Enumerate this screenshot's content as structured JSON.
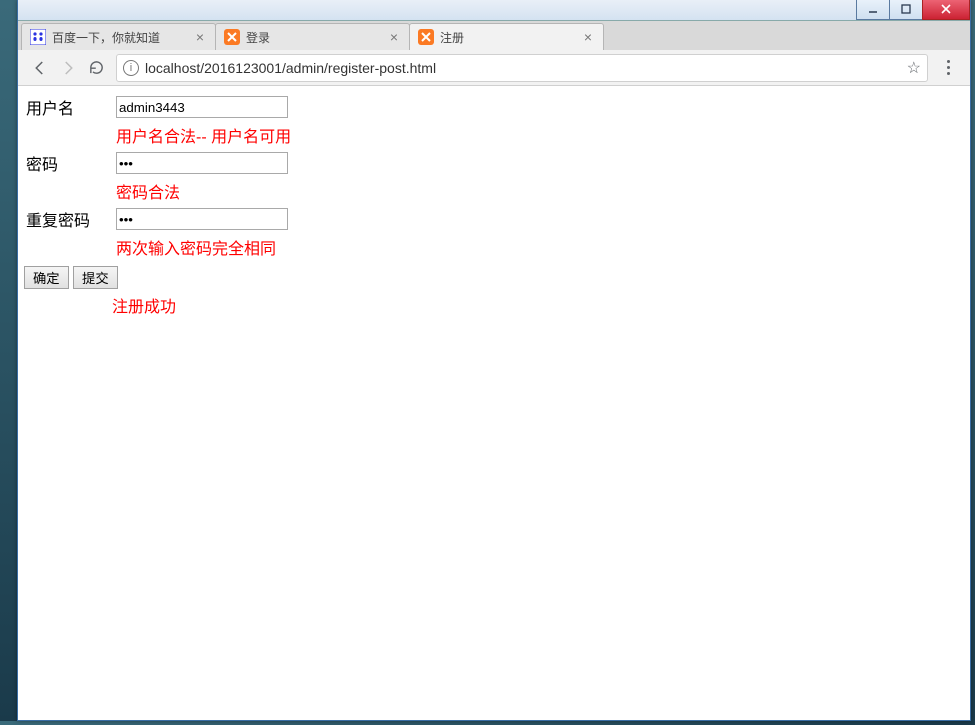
{
  "window": {
    "controls": {
      "min": "minimize",
      "max": "maximize",
      "close": "close"
    }
  },
  "tabs": [
    {
      "title": "百度一下，你就知道",
      "favicon": "baidu"
    },
    {
      "title": "登录",
      "favicon": "xampp"
    },
    {
      "title": "注册",
      "favicon": "xampp",
      "active": true
    }
  ],
  "toolbar": {
    "url": "localhost/2016123001/admin/register-post.html"
  },
  "form": {
    "username_label": "用户名",
    "username_value": "admin3443",
    "username_msg": "用户名合法-- 用户名可用",
    "password_label": "密码",
    "password_value": "•••",
    "password_msg": "密码合法",
    "repeat_label": "重复密码",
    "repeat_value": "•••",
    "repeat_msg": "两次输入密码完全相同",
    "ok_btn": "确定",
    "submit_btn": "提交",
    "result_msg": "注册成功"
  }
}
